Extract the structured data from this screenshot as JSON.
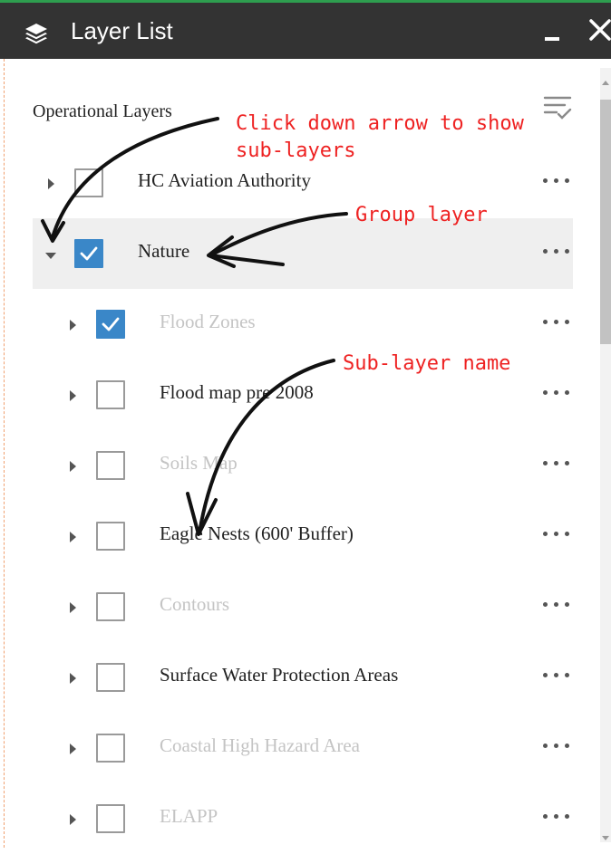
{
  "window": {
    "title": "Layer List",
    "icon": "layers-icon",
    "accent_color": "#2e9e4f",
    "header_color": "#333333"
  },
  "panel": {
    "section_label": "Operational Layers",
    "filter_icon": "filter-list-icon"
  },
  "layers": [
    {
      "name": "HC Aviation Authority",
      "checked": false,
      "expanded": false,
      "level": 0,
      "dimmed": false
    },
    {
      "name": "Nature",
      "checked": true,
      "expanded": true,
      "level": 0,
      "dimmed": false,
      "selected": true
    },
    {
      "name": "Flood Zones",
      "checked": true,
      "expanded": false,
      "level": 1,
      "dimmed": true
    },
    {
      "name": "Flood map pre 2008",
      "checked": false,
      "expanded": false,
      "level": 1,
      "dimmed": false
    },
    {
      "name": "Soils Map",
      "checked": false,
      "expanded": false,
      "level": 1,
      "dimmed": true
    },
    {
      "name": "Eagle Nests (600' Buffer)",
      "checked": false,
      "expanded": false,
      "level": 1,
      "dimmed": false
    },
    {
      "name": "Contours",
      "checked": false,
      "expanded": false,
      "level": 1,
      "dimmed": true
    },
    {
      "name": "Surface Water Protection Areas",
      "checked": false,
      "expanded": false,
      "level": 1,
      "dimmed": false
    },
    {
      "name": "Coastal High Hazard Area",
      "checked": false,
      "expanded": false,
      "level": 1,
      "dimmed": true
    },
    {
      "name": "ELAPP",
      "checked": false,
      "expanded": false,
      "level": 1,
      "dimmed": true
    }
  ],
  "annotations": {
    "arrow_expand": "Click down arrow to show\nsub-layers",
    "group_layer": "Group layer",
    "sublayer_name": "Sub-layer name",
    "color": "#ee2222"
  },
  "colors": {
    "checkbox_checked": "#3a87c8",
    "dimmed_text": "#c4c4c4"
  }
}
